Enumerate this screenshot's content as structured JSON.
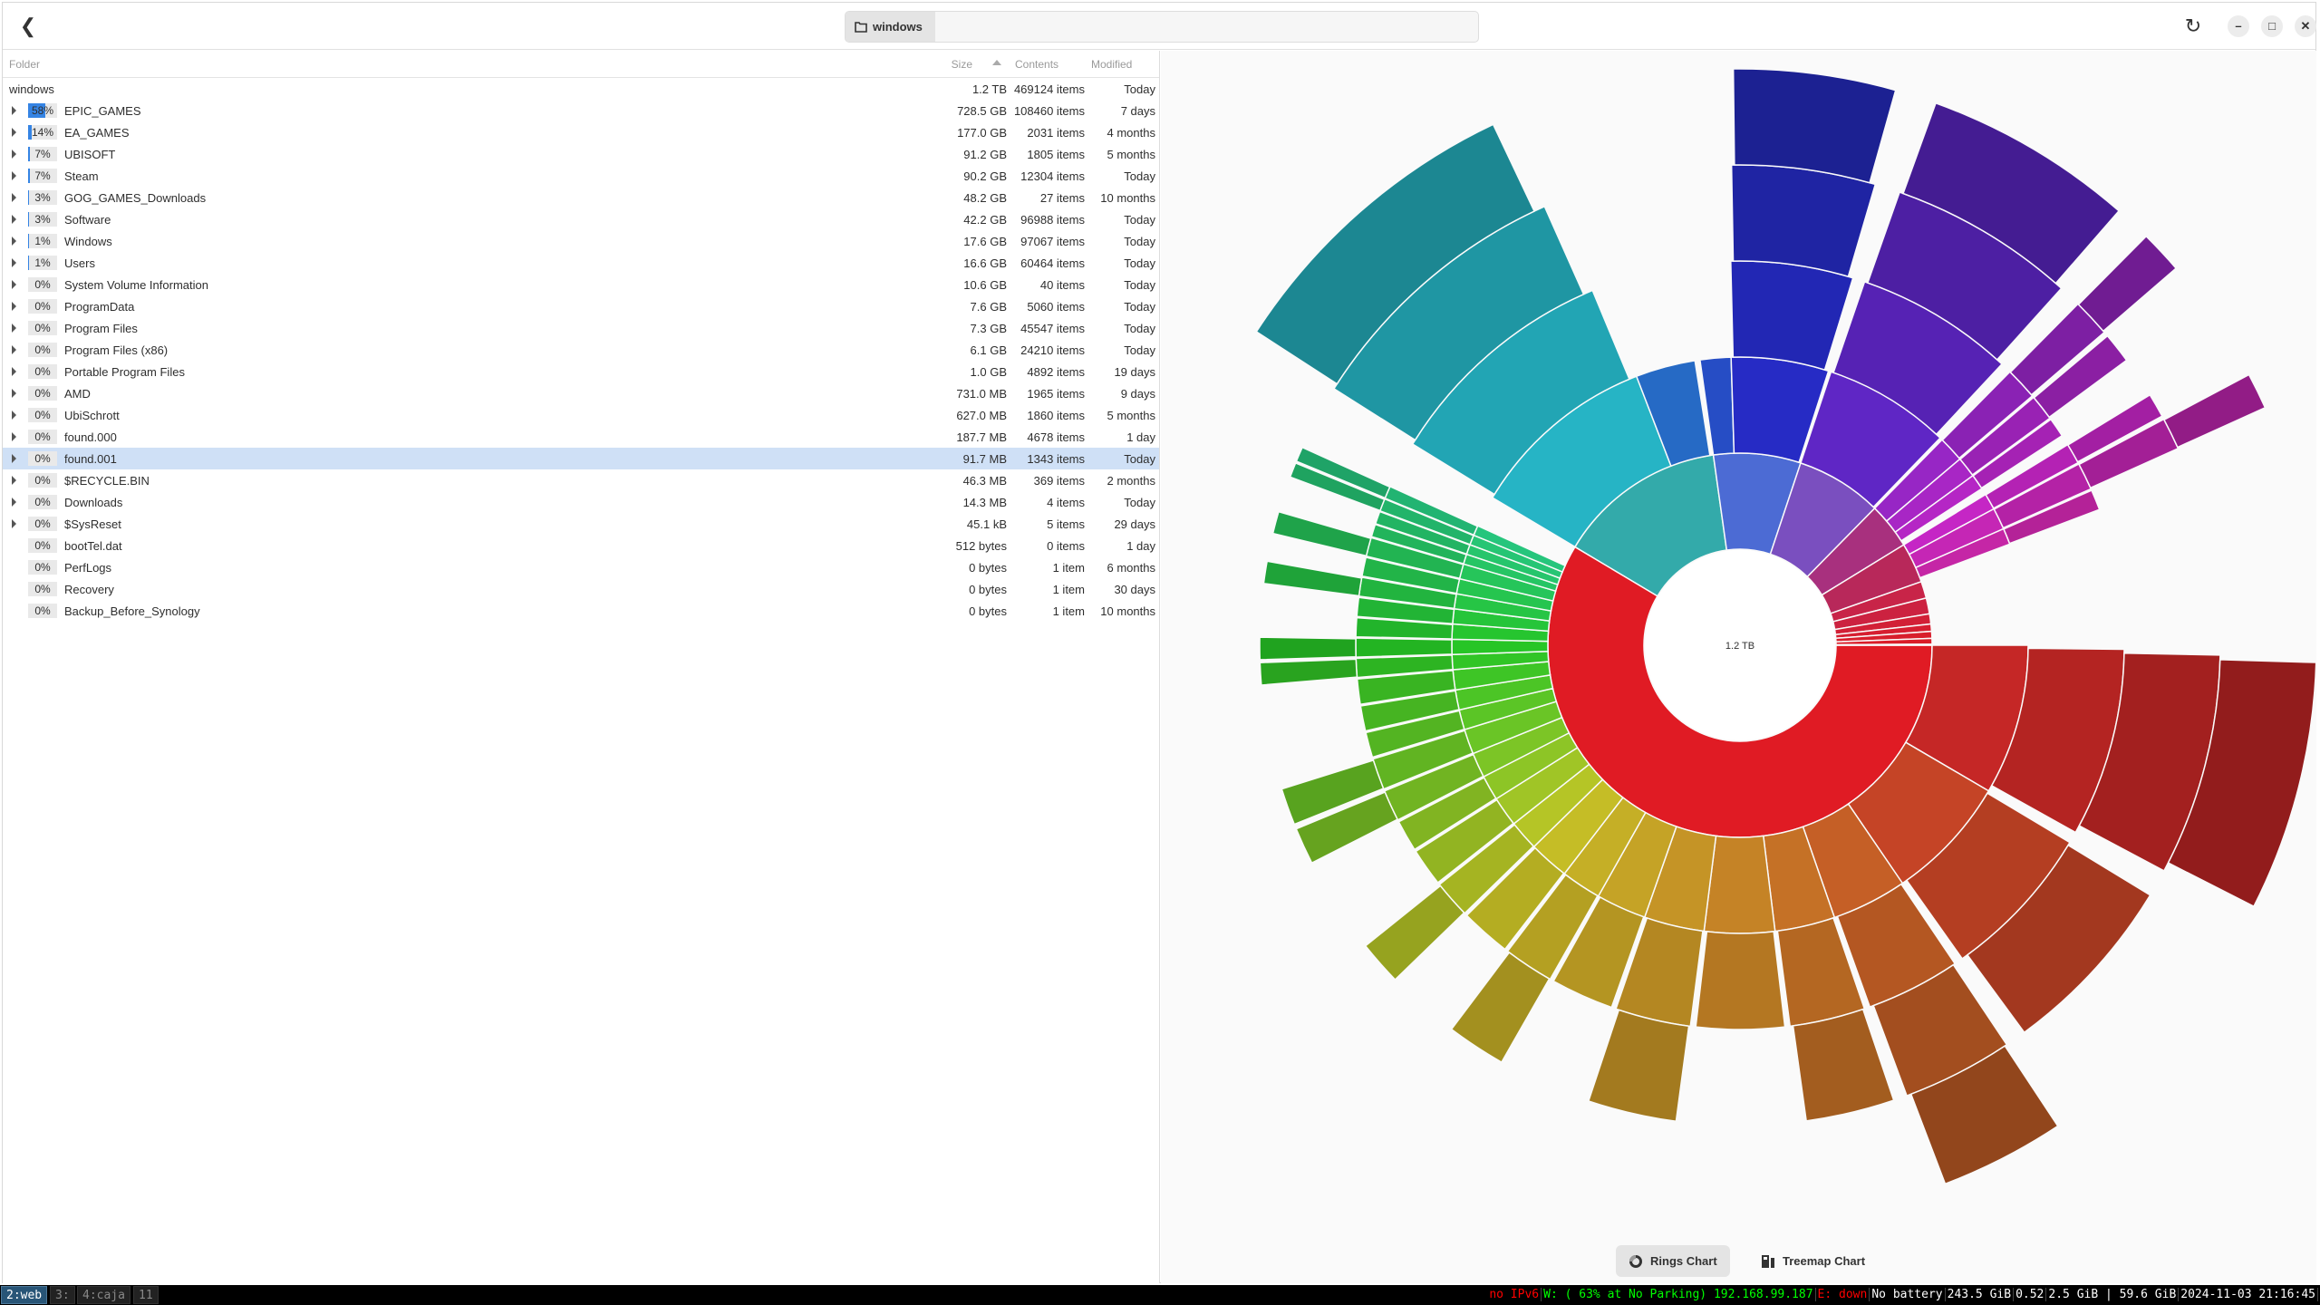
{
  "header": {
    "breadcrumb": "windows",
    "back_icon": "chevron-left-icon",
    "folder_icon": "folder-icon"
  },
  "columns": {
    "folder": "Folder",
    "size": "Size",
    "contents": "Contents",
    "modified": "Modified"
  },
  "root": {
    "name": "windows",
    "size": "1.2 TB",
    "contents": "469124 items",
    "modified": "Today"
  },
  "rows": [
    {
      "pct": 58,
      "pct_label": "58%",
      "name": "EPIC_GAMES",
      "size": "728.5 GB",
      "contents": "108460 items",
      "modified": "7 days",
      "expandable": true
    },
    {
      "pct": 14,
      "pct_label": "14%",
      "name": "EA_GAMES",
      "size": "177.0 GB",
      "contents": "2031 items",
      "modified": "4 months",
      "expandable": true
    },
    {
      "pct": 7,
      "pct_label": "7%",
      "name": "UBISOFT",
      "size": "91.2 GB",
      "contents": "1805 items",
      "modified": "5 months",
      "expandable": true
    },
    {
      "pct": 7,
      "pct_label": "7%",
      "name": "Steam",
      "size": "90.2 GB",
      "contents": "12304 items",
      "modified": "Today",
      "expandable": true
    },
    {
      "pct": 3,
      "pct_label": "3%",
      "name": "GOG_GAMES_Downloads",
      "size": "48.2 GB",
      "contents": "27 items",
      "modified": "10 months",
      "expandable": true
    },
    {
      "pct": 3,
      "pct_label": "3%",
      "name": "Software",
      "size": "42.2 GB",
      "contents": "96988 items",
      "modified": "Today",
      "expandable": true
    },
    {
      "pct": 1,
      "pct_label": "1%",
      "name": "Windows",
      "size": "17.6 GB",
      "contents": "97067 items",
      "modified": "Today",
      "expandable": true
    },
    {
      "pct": 1,
      "pct_label": "1%",
      "name": "Users",
      "size": "16.6 GB",
      "contents": "60464 items",
      "modified": "Today",
      "expandable": true
    },
    {
      "pct": 0,
      "pct_label": "0%",
      "name": "System Volume Information",
      "size": "10.6 GB",
      "contents": "40 items",
      "modified": "Today",
      "expandable": true
    },
    {
      "pct": 0,
      "pct_label": "0%",
      "name": "ProgramData",
      "size": "7.6 GB",
      "contents": "5060 items",
      "modified": "Today",
      "expandable": true
    },
    {
      "pct": 0,
      "pct_label": "0%",
      "name": "Program Files",
      "size": "7.3 GB",
      "contents": "45547 items",
      "modified": "Today",
      "expandable": true
    },
    {
      "pct": 0,
      "pct_label": "0%",
      "name": "Program Files (x86)",
      "size": "6.1 GB",
      "contents": "24210 items",
      "modified": "Today",
      "expandable": true
    },
    {
      "pct": 0,
      "pct_label": "0%",
      "name": "Portable Program Files",
      "size": "1.0 GB",
      "contents": "4892 items",
      "modified": "19 days",
      "expandable": true
    },
    {
      "pct": 0,
      "pct_label": "0%",
      "name": "AMD",
      "size": "731.0 MB",
      "contents": "1965 items",
      "modified": "9 days",
      "expandable": true
    },
    {
      "pct": 0,
      "pct_label": "0%",
      "name": "UbiSchrott",
      "size": "627.0 MB",
      "contents": "1860 items",
      "modified": "5 months",
      "expandable": true
    },
    {
      "pct": 0,
      "pct_label": "0%",
      "name": "found.000",
      "size": "187.7 MB",
      "contents": "4678 items",
      "modified": "1 day",
      "expandable": true
    },
    {
      "pct": 0,
      "pct_label": "0%",
      "name": "found.001",
      "size": "91.7 MB",
      "contents": "1343 items",
      "modified": "Today",
      "expandable": true,
      "selected": true
    },
    {
      "pct": 0,
      "pct_label": "0%",
      "name": "$RECYCLE.BIN",
      "size": "46.3 MB",
      "contents": "369 items",
      "modified": "2 months",
      "expandable": true
    },
    {
      "pct": 0,
      "pct_label": "0%",
      "name": "Downloads",
      "size": "14.3 MB",
      "contents": "4 items",
      "modified": "Today",
      "expandable": true
    },
    {
      "pct": 0,
      "pct_label": "0%",
      "name": "$SysReset",
      "size": "45.1 kB",
      "contents": "5 items",
      "modified": "29 days",
      "expandable": true
    },
    {
      "pct": 0,
      "pct_label": "0%",
      "name": "bootTel.dat",
      "size": "512 bytes",
      "contents": "0 items",
      "modified": "1 day",
      "expandable": false
    },
    {
      "pct": 0,
      "pct_label": "0%",
      "name": "PerfLogs",
      "size": "0 bytes",
      "contents": "1 item",
      "modified": "6 months",
      "expandable": false
    },
    {
      "pct": 0,
      "pct_label": "0%",
      "name": "Recovery",
      "size": "0 bytes",
      "contents": "1 item",
      "modified": "30 days",
      "expandable": false
    },
    {
      "pct": 0,
      "pct_label": "0%",
      "name": "Backup_Before_Synology",
      "size": "0 bytes",
      "contents": "1 item",
      "modified": "10 months",
      "expandable": false
    }
  ],
  "chart_data": {
    "type": "sunburst",
    "center_label": "1.2 TB",
    "segments": [
      {
        "name": "EPIC_GAMES",
        "size_gb": 728.5,
        "color": "#e01b24",
        "coverage": 0.97,
        "children": [
          [
            30,
            4
          ],
          [
            25,
            3
          ],
          [
            15,
            4
          ],
          [
            12,
            3
          ],
          [
            14,
            2
          ],
          [
            12,
            3
          ],
          [
            10,
            2
          ],
          [
            8,
            3
          ],
          [
            8,
            2
          ],
          [
            6,
            3
          ],
          [
            6,
            2
          ],
          [
            5,
            2
          ],
          [
            5,
            3
          ],
          [
            5,
            3
          ],
          [
            4,
            2
          ],
          [
            4,
            2
          ],
          [
            4,
            2
          ],
          [
            3,
            3
          ],
          [
            3,
            3
          ],
          [
            3,
            2
          ],
          [
            3,
            2
          ],
          [
            3,
            3
          ],
          [
            3,
            2
          ],
          [
            3,
            3
          ],
          [
            2,
            2
          ],
          [
            2,
            2
          ],
          [
            2,
            3
          ],
          [
            2,
            3
          ]
        ]
      },
      {
        "name": "EA_GAMES",
        "size_gb": 177.0,
        "color": "#33aaaa",
        "coverage": 0.98,
        "children": [
          [
            38,
            4
          ],
          [
            12,
            1
          ]
        ]
      },
      {
        "name": "UBISOFT",
        "size_gb": 91.2,
        "color": "#4c6bd4",
        "coverage": 0.98,
        "children": [
          [
            6,
            1
          ],
          [
            19,
            4
          ]
        ]
      },
      {
        "name": "Steam",
        "size_gb": 90.2,
        "color": "#7a4fbf",
        "coverage": 0.98,
        "children": [
          [
            25,
            4
          ]
        ]
      },
      {
        "name": "GOG_GAMES_Downloads",
        "size_gb": 48.2,
        "color": "#a8307e",
        "coverage": 0.9,
        "children": [
          [
            5,
            4
          ],
          [
            4,
            3
          ],
          [
            3,
            2
          ]
        ]
      },
      {
        "name": "Software",
        "size_gb": 42.2,
        "color": "#b8285a",
        "coverage": 0.9,
        "children": [
          [
            3,
            3
          ],
          [
            4,
            4
          ],
          [
            3,
            2
          ]
        ]
      },
      {
        "name": "Windows",
        "size_gb": 17.6,
        "color": "#c82448"
      },
      {
        "name": "Users",
        "size_gb": 16.6,
        "color": "#cc2240"
      },
      {
        "name": "System Volume Information",
        "size_gb": 10.6,
        "color": "#d22036"
      },
      {
        "name": "ProgramData",
        "size_gb": 7.6,
        "color": "#d61e30"
      },
      {
        "name": "Program Files",
        "size_gb": 7.3,
        "color": "#d81e2c"
      },
      {
        "name": "Program Files (x86)",
        "size_gb": 6.1,
        "color": "#da1d28"
      },
      {
        "name": "Portable Program Files",
        "size_gb": 1.0,
        "color": "#dc1c26"
      }
    ]
  },
  "chart_tabs": {
    "rings": "Rings Chart",
    "treemap": "Treemap Chart",
    "active": "rings"
  },
  "statusbar": {
    "workspaces": [
      {
        "label": "2:web",
        "active": true
      },
      {
        "label": "3:"
      },
      {
        "label": "4:caja"
      },
      {
        "label": "11"
      }
    ],
    "items": [
      {
        "text": "no IPv6",
        "color": "#ff0000"
      },
      {
        "text": "W: ( 63% at No Parking) 192.168.99.187",
        "color": "#00ff00"
      },
      {
        "text": "E: down",
        "color": "#ff0000"
      },
      {
        "text": "No battery",
        "color": "#ffffff"
      },
      {
        "text": "243.5 GiB",
        "color": "#ffffff"
      },
      {
        "text": "0.52",
        "color": "#ffffff"
      },
      {
        "text": "2.5 GiB | 59.6 GiB",
        "color": "#ffffff"
      },
      {
        "text": "2024-11-03 21:16:45",
        "color": "#ffffff"
      }
    ]
  }
}
